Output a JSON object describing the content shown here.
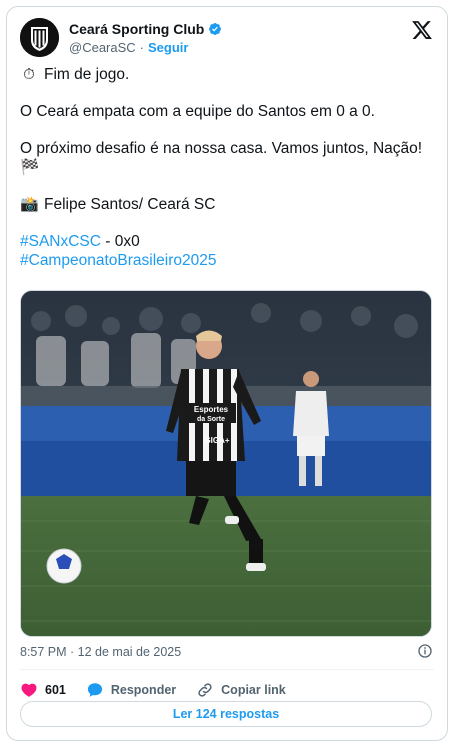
{
  "header": {
    "name": "Ceará Sporting Club",
    "handle": "@CearaSC",
    "separator": "·",
    "follow_label": "Seguir"
  },
  "tweet": {
    "line1_emoji": "⏱",
    "line1": "Fim de jogo.",
    "line2": "O Ceará empata com a equipe do Santos em 0 a 0.",
    "line3": "O próximo desafio é na nossa casa. Vamos juntos, Nação!",
    "line3_emoji": "🏁",
    "line4_emoji": "📸",
    "line4": "Felipe Santos/ Ceará SC",
    "hashtag1": "#SANxCSC",
    "hashtag1_suffix": " - 0x0",
    "hashtag2": "#CampeonatoBrasileiro2025"
  },
  "media": {
    "description_icon": "photo",
    "jersey_sponsor": "Esportes da Sorte",
    "jersey_sponsor_lines": [
      "Esportes",
      "da Sorte"
    ],
    "jersey_sponsor2": "GIGA+"
  },
  "timestamp": "8:57 PM · 12 de mai de 2025",
  "actions": {
    "like_count": "601",
    "reply_label": "Responder",
    "copy_label": "Copiar link"
  },
  "replies_button": "Ler 124 respostas",
  "colors": {
    "accent": "#1d9bf0",
    "like": "#f91880",
    "muted": "#536471"
  }
}
